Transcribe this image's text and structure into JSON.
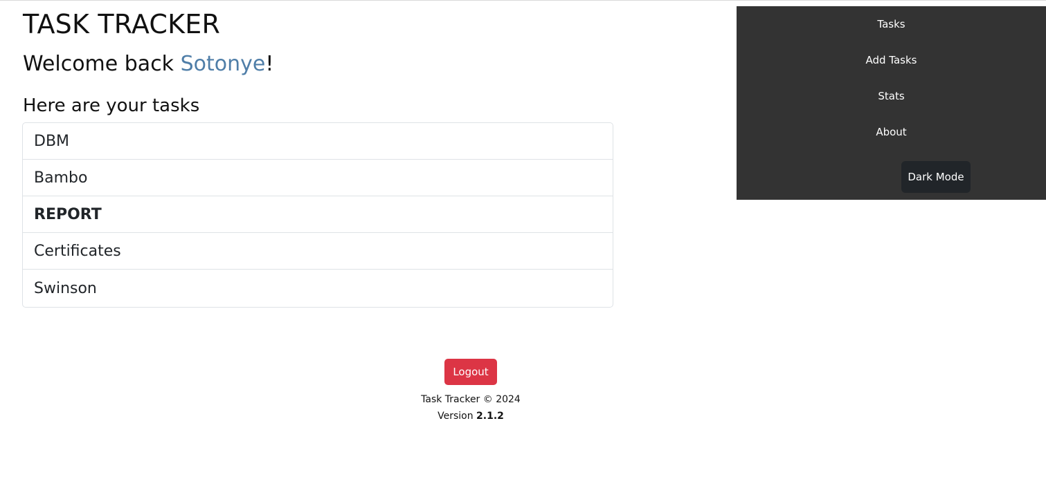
{
  "header": {
    "app_title": "TASK TRACKER",
    "welcome_prefix": "Welcome back ",
    "username": "Sotonye",
    "welcome_suffix": "!"
  },
  "main": {
    "tasks_heading": "Here are your tasks",
    "tasks": [
      {
        "label": "DBM",
        "bold": false
      },
      {
        "label": "Bambo",
        "bold": false
      },
      {
        "label": "REPORT",
        "bold": true
      },
      {
        "label": "Certificates",
        "bold": false
      },
      {
        "label": "Swinson",
        "bold": false
      }
    ]
  },
  "nav": {
    "items": [
      "Tasks",
      "Add Tasks",
      "Stats",
      "About"
    ],
    "dark_mode_label": "Dark Mode"
  },
  "footer": {
    "logout_label": "Logout",
    "copyright": "Task Tracker © 2024",
    "version_prefix": "Version ",
    "version_number": "2.1.2"
  },
  "colors": {
    "username_accent": "#4f7ea8",
    "nav_background": "#333333",
    "dark_button": "#212529",
    "logout_button": "#dc3545"
  }
}
